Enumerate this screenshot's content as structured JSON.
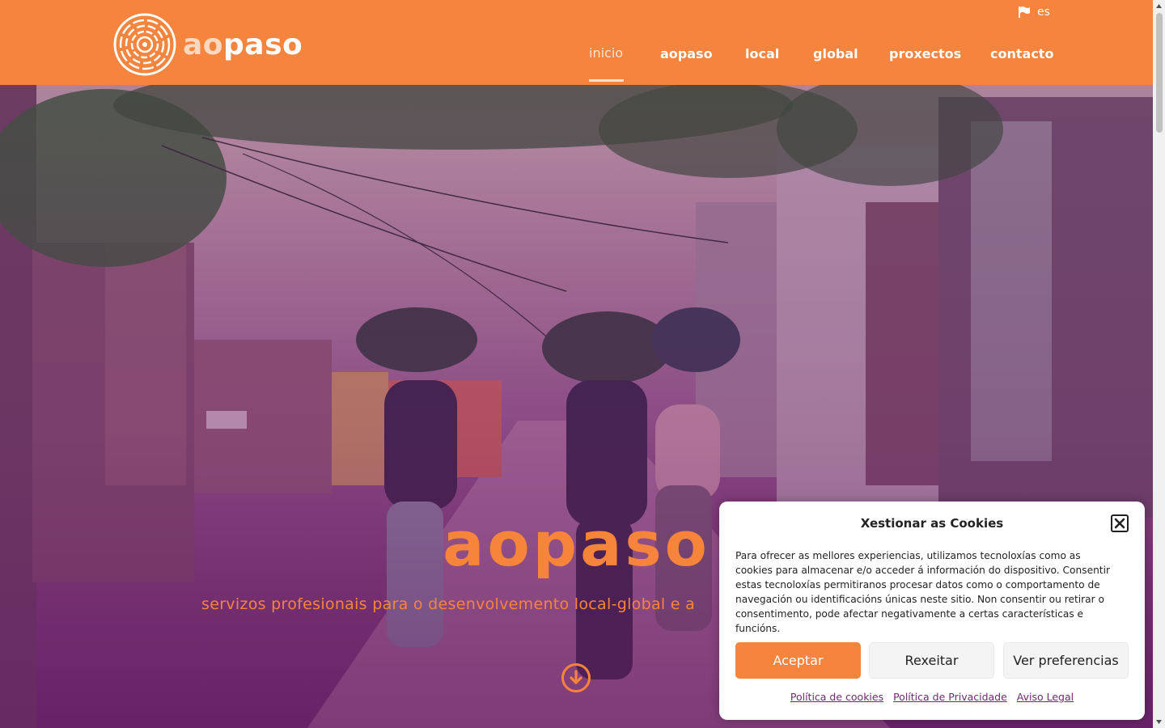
{
  "header": {
    "logo_text_light": "ao",
    "logo_text_bold": "paso",
    "lang_label": "es",
    "nav": [
      {
        "label": "inicio",
        "active": true
      },
      {
        "label": "aopaso"
      },
      {
        "label": "local"
      },
      {
        "label": "global"
      },
      {
        "label": "proxectos"
      },
      {
        "label": "contacto"
      }
    ]
  },
  "hero": {
    "title": "aopaso",
    "subtitle": "servizos profesionais para o desenvolvemento local-global e a"
  },
  "cookie": {
    "title": "Xestionar as Cookies",
    "body": "Para ofrecer as mellores experiencias, utilizamos tecnoloxías como as cookies para almacenar e/o acceder á información do dispositivo. Consentir estas tecnoloxías permitiranos procesar datos como o comportamento de navegación ou identificacións únicas neste sitio. Non consentir ou retirar o consentimento, pode afectar negativamente a certas características e funcións.",
    "accept": "Aceptar",
    "reject": "Rexeitar",
    "prefs": "Ver preferencias",
    "links": [
      "Política de cookies",
      "Política de Privacidade",
      "Aviso Legal"
    ]
  },
  "colors": {
    "brand_orange": "#f4843e",
    "hero_text_orange": "#f7843b",
    "link_purple": "#6d2c6d"
  }
}
